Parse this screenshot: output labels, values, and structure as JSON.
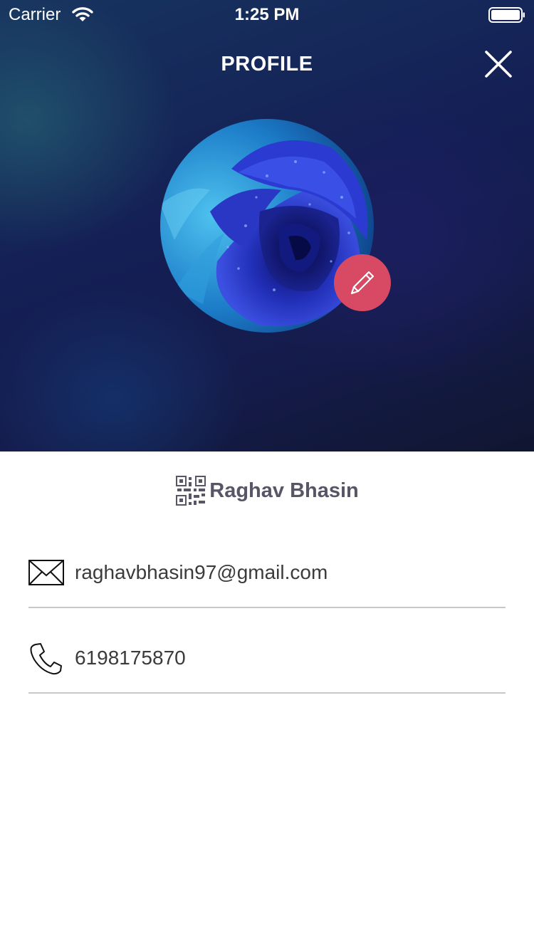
{
  "status_bar": {
    "carrier": "Carrier",
    "time": "1:25 PM"
  },
  "header": {
    "title": "PROFILE"
  },
  "profile": {
    "name": "Raghav Bhasin",
    "email": "raghavbhasin97@gmail.com",
    "phone": "6198175870"
  },
  "icons": {
    "close": "close-icon",
    "edit": "pencil-icon",
    "qr": "qr-code-icon",
    "email": "envelope-icon",
    "phone": "phone-icon"
  },
  "colors": {
    "edit_button": "#d84a63",
    "name_text": "#565667",
    "divider": "#c8c8c8"
  }
}
